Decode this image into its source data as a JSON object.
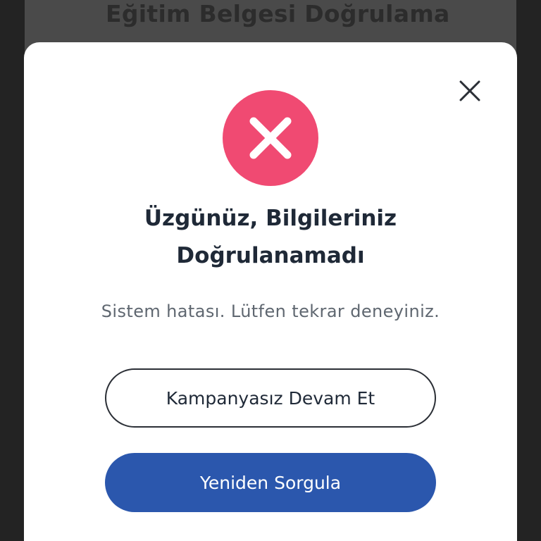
{
  "background": {
    "title": "Eğitim Belgesi Doğrulama"
  },
  "modal": {
    "status_icon": "error-x-icon",
    "close_icon": "close-icon",
    "title_line1": "Üzgünüz, Bilgileriniz",
    "title_line2": "Doğrulanamadı",
    "message": "Sistem hatası. Lütfen tekrar deneyiniz.",
    "secondary_button_label": "Kampanyasız Devam Et",
    "primary_button_label": "Yeniden Sorgula"
  },
  "colors": {
    "error": "#f04a72",
    "primary": "#2b57ad",
    "text_dark": "#1f2937",
    "text_muted": "#5f6770"
  }
}
